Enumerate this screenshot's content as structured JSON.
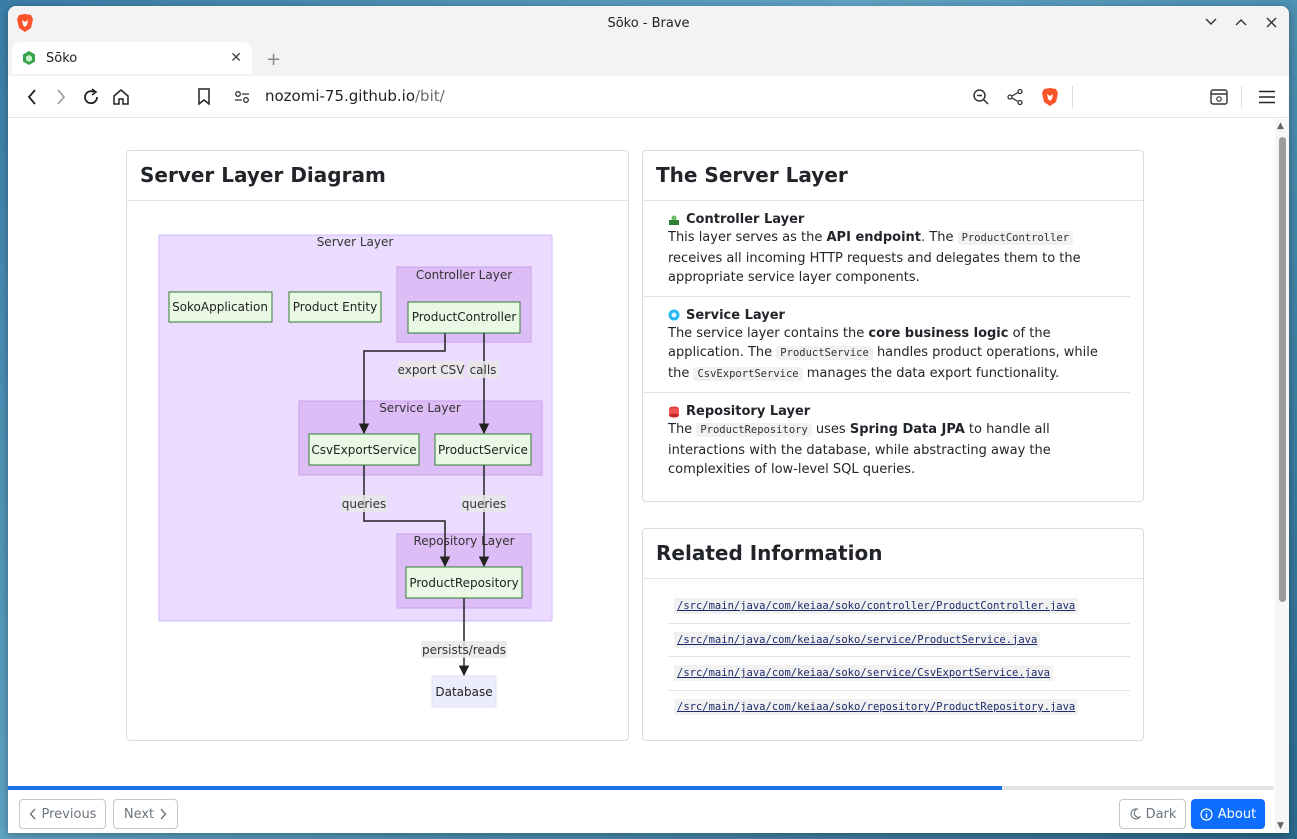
{
  "window": {
    "title": "Sōko - Brave"
  },
  "tab": {
    "title": "Sōko"
  },
  "address": {
    "host": "nozomi-75.github.io",
    "path": "/bit/"
  },
  "diagram_card": {
    "title": "Server Layer Diagram",
    "groups": {
      "server": "Server Layer",
      "controller": "Controller Layer",
      "service": "Service Layer",
      "repository": "Repository Layer"
    },
    "nodes": {
      "app": "SokoApplication",
      "entity": "Product Entity",
      "controller": "ProductController",
      "csv": "CsvExportService",
      "product_service": "ProductService",
      "repo": "ProductRepository",
      "db": "Database"
    },
    "edges": {
      "export": "export CSV",
      "calls": "calls",
      "queries1": "queries",
      "queries2": "queries",
      "persists": "persists/reads"
    }
  },
  "server_card": {
    "title": "The Server Layer",
    "controller": {
      "heading": "Controller Layer",
      "t1": "This layer serves as the ",
      "b1": "API endpoint",
      "t2": ". The ",
      "c1": "ProductController",
      "t3": " receives all incoming HTTP requests and delegates them to the appropriate service layer components."
    },
    "service": {
      "heading": "Service Layer",
      "t1": "The service layer contains the ",
      "b1": "core business logic",
      "t2": " of the application. The ",
      "c1": "ProductService",
      "t3": " handles product operations, while the ",
      "c2": "CsvExportService",
      "t4": " manages the data export functionality."
    },
    "repository": {
      "heading": "Repository Layer",
      "t1": "The ",
      "c1": "ProductRepository",
      "t2": " uses ",
      "b1": "Spring Data JPA",
      "t3": " to handle all interactions with the database, while abstracting away the complexities of low-level SQL queries."
    }
  },
  "related_card": {
    "title": "Related Information",
    "links": [
      "/src/main/java/com/keiaa/soko/controller/ProductController.java",
      "/src/main/java/com/keiaa/soko/service/ProductService.java",
      "/src/main/java/com/keiaa/soko/service/CsvExportService.java",
      "/src/main/java/com/keiaa/soko/repository/ProductRepository.java"
    ]
  },
  "footer": {
    "previous": "Previous",
    "next": "Next",
    "dark": "Dark",
    "about": "About",
    "progress": 0.785
  },
  "colors": {
    "accent": "#0d6efd",
    "progress": "#1a73e8",
    "server_group": "#eadbff",
    "sub_group": "#dcbdf5",
    "node_fill": "#e9f9e6",
    "node_border": "#2f7d32",
    "db_fill": "#ececff"
  },
  "icons": [
    "brave-lion-icon",
    "minimize-icon",
    "maximize-icon",
    "close-icon",
    "back-icon",
    "forward-icon",
    "reload-icon",
    "home-icon",
    "bookmark-icon",
    "site-settings-icon",
    "zoom-out-icon",
    "share-icon",
    "brave-shields-icon",
    "leo-sidebar-icon",
    "menu-icon"
  ]
}
